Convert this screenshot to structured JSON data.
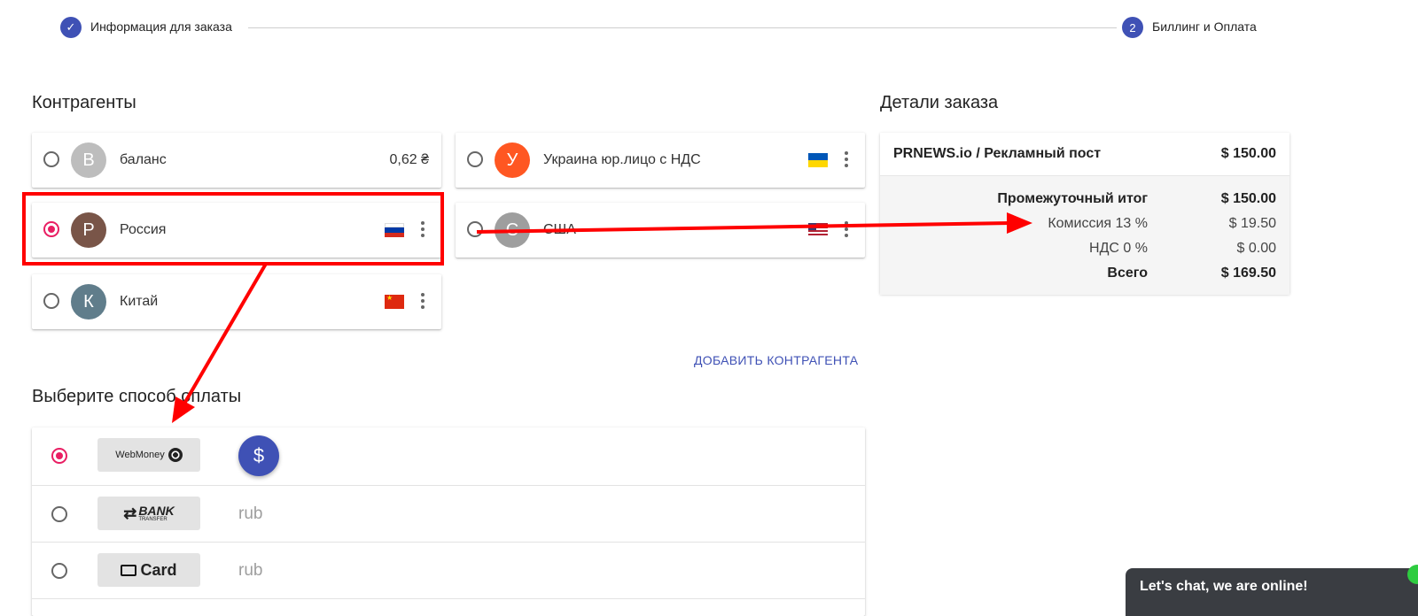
{
  "stepper": {
    "step1_label": "Информация для заказа",
    "step2_number": "2",
    "step2_label": "Биллинг и Оплата"
  },
  "counterparties": {
    "heading": "Контрагенты",
    "items": [
      {
        "initial": "B",
        "name": "баланс",
        "balance": "0,62 ₴",
        "avatar_color": "#bdbdbd",
        "selected": false
      },
      {
        "initial": "У",
        "name": "Украина юр.лицо с НДС",
        "flag": "ukraine-flag-icon",
        "avatar_color": "#ff5722",
        "selected": false
      },
      {
        "initial": "Р",
        "name": "Россия",
        "flag": "russia-flag-icon",
        "avatar_color": "#795548",
        "selected": true
      },
      {
        "initial": "С",
        "name": "США",
        "flag": "usa-flag-icon",
        "avatar_color": "#9e9e9e",
        "selected": false
      },
      {
        "initial": "К",
        "name": "Китай",
        "flag": "china-flag-icon",
        "avatar_color": "#607d8b",
        "selected": false
      }
    ],
    "add_button": "ДОБАВИТЬ КОНТРАГЕНТА"
  },
  "payment": {
    "heading": "Выберите способ оплаты",
    "methods": [
      {
        "logo": "WebMoney",
        "currency": "",
        "selected": true
      },
      {
        "logo": "BANK",
        "logo_sub": "TRANSFER",
        "currency": "rub",
        "selected": false
      },
      {
        "logo": "Card",
        "currency": "rub",
        "selected": false
      }
    ],
    "fab_symbol": "$"
  },
  "order": {
    "heading": "Детали заказа",
    "item_name": "PRNEWS.io / Рекламный пост",
    "item_price": "$ 150.00",
    "subtotal_label": "Промежуточный итог",
    "subtotal_value": "$ 150.00",
    "commission_label": "Комиссия 13 %",
    "commission_value": "$ 19.50",
    "vat_label": "НДС 0 %",
    "vat_value": "$ 0.00",
    "total_label": "Всего",
    "total_value": "$ 169.50"
  },
  "chat": {
    "label": "Let's chat, we are online!"
  },
  "colors": {
    "accent": "#3f51b5",
    "radio_active": "#e91e63",
    "annotation": "#ff0000"
  }
}
